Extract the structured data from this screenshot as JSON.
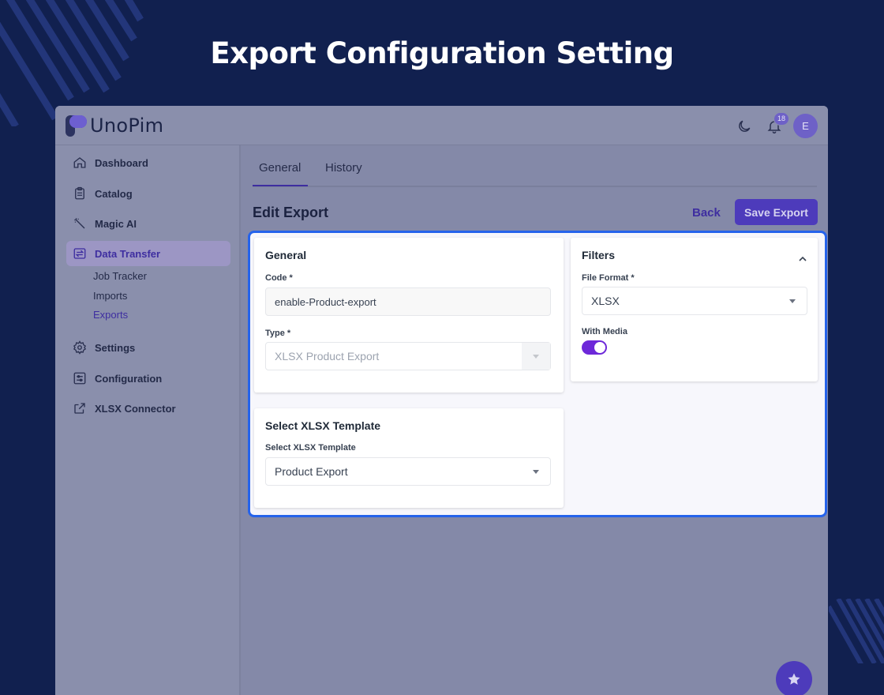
{
  "banner": {
    "title": "Export Configuration Setting"
  },
  "app": {
    "brand": "UnoPim",
    "notifications_count": "18",
    "user_initial": "E"
  },
  "sidebar": {
    "items": [
      {
        "label": "Dashboard",
        "icon": "home-icon"
      },
      {
        "label": "Catalog",
        "icon": "clipboard-icon"
      },
      {
        "label": "Magic AI",
        "icon": "magic-wand-icon"
      },
      {
        "label": "Data Transfer",
        "icon": "transfer-icon",
        "active": true
      },
      {
        "label": "Settings",
        "icon": "gear-icon"
      },
      {
        "label": "Configuration",
        "icon": "sliders-icon"
      },
      {
        "label": "XLSX Connector",
        "icon": "share-icon"
      }
    ],
    "sub_items": [
      {
        "label": "Job Tracker"
      },
      {
        "label": "Imports"
      },
      {
        "label": "Exports",
        "active": true
      }
    ]
  },
  "tabs": [
    {
      "label": "General",
      "active": true
    },
    {
      "label": "History"
    }
  ],
  "page": {
    "title": "Edit Export",
    "back_label": "Back",
    "save_label": "Save Export"
  },
  "general_card": {
    "title": "General",
    "code_label": "Code *",
    "code_value": "enable-Product-export",
    "type_label": "Type *",
    "type_value": "XLSX Product Export"
  },
  "template_card": {
    "title": "Select XLSX Template",
    "field_label": "Select XLSX Template",
    "value": "Product Export"
  },
  "filters_card": {
    "title": "Filters",
    "file_format_label": "File Format *",
    "file_format_value": "XLSX",
    "with_media_label": "With Media",
    "with_media_enabled": true
  },
  "colors": {
    "background": "#11204f",
    "accent": "#4d3bbb",
    "highlight": "#2563eb",
    "toggle": "#6d28d9"
  }
}
